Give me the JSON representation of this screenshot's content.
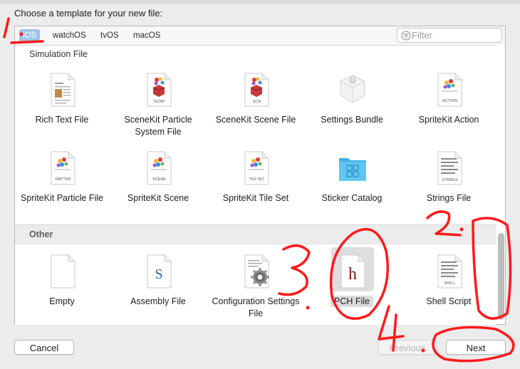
{
  "dialog": {
    "prompt": "Choose a template for your new file:"
  },
  "platform_tabs": [
    "iOS",
    "watchOS",
    "tvOS",
    "macOS"
  ],
  "active_tab": "iOS",
  "filter": {
    "placeholder": "Filter",
    "value": ""
  },
  "sections": {
    "partial_label": "Simulation File",
    "other_header": "Other"
  },
  "resource_templates": [
    {
      "label": "Rich Text File",
      "icon": "rich-text-document-icon"
    },
    {
      "label": "SceneKit Particle System File",
      "icon": "scenekit-particle-icon",
      "badge": "SCNP"
    },
    {
      "label": "SceneKit Scene File",
      "icon": "scenekit-scene-icon",
      "badge": "SCN"
    },
    {
      "label": "Settings Bundle",
      "icon": "settings-bundle-icon"
    },
    {
      "label": "SpriteKit Action",
      "icon": "spritekit-action-icon",
      "badge": "ACTION"
    },
    {
      "label": "SpriteKit Particle File",
      "icon": "spritekit-particle-icon",
      "badge": "EMITTER"
    },
    {
      "label": "SpriteKit Scene",
      "icon": "spritekit-scene-icon",
      "badge": "SCENE"
    },
    {
      "label": "SpriteKit Tile Set",
      "icon": "spritekit-tileset-icon",
      "badge": "TILE SET"
    },
    {
      "label": "Sticker Catalog",
      "icon": "sticker-catalog-folder-icon"
    },
    {
      "label": "Strings File",
      "icon": "strings-file-icon",
      "badge": "STRINGS"
    }
  ],
  "other_templates": [
    {
      "label": "Empty",
      "icon": "empty-file-icon"
    },
    {
      "label": "Assembly File",
      "icon": "assembly-file-icon",
      "glyph": "S"
    },
    {
      "label": "Configuration Settings File",
      "icon": "configuration-settings-icon"
    },
    {
      "label": "PCH File",
      "icon": "pch-file-icon",
      "glyph": "h",
      "selected": true
    },
    {
      "label": "Shell Script",
      "icon": "shell-script-icon",
      "badge": "SHELL"
    }
  ],
  "buttons": {
    "cancel": "Cancel",
    "previous": "Previous",
    "next": "Next"
  },
  "annotations": [
    "1.",
    "2.",
    "3.",
    "4."
  ],
  "colors": {
    "selection_tab": "#9fc3ea",
    "folder_blue": "#3fb2e8",
    "annotation_red": "#ff1a1a",
    "pch_glyph": "#8b1515"
  }
}
